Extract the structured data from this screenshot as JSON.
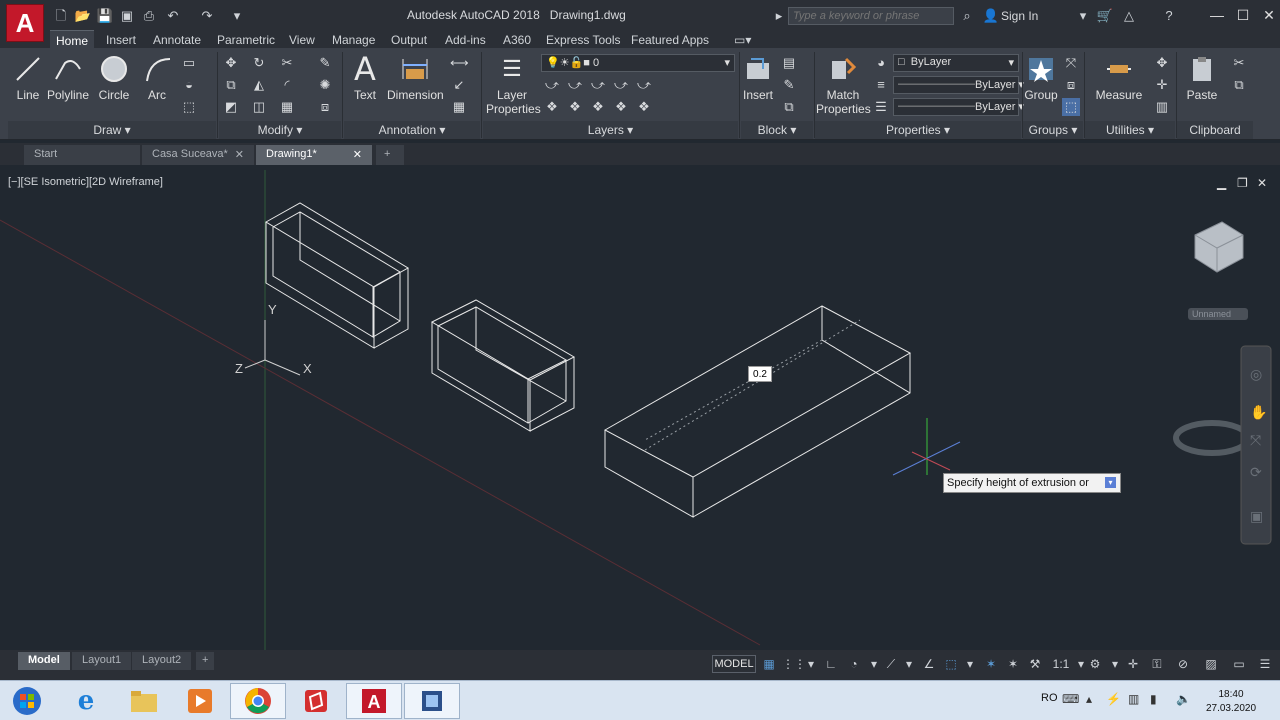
{
  "app": {
    "title": "Autodesk AutoCAD 2018",
    "document": "Drawing1.dwg",
    "logo_letter": "A"
  },
  "search": {
    "placeholder": "Type a keyword or phrase"
  },
  "signin": {
    "label": "Sign In"
  },
  "ribbon_tabs": [
    "Home",
    "Insert",
    "Annotate",
    "Parametric",
    "View",
    "Manage",
    "Output",
    "Add-ins",
    "A360",
    "Express Tools",
    "Featured Apps"
  ],
  "draw": {
    "line": "Line",
    "polyline": "Polyline",
    "circle": "Circle",
    "arc": "Arc",
    "footer": "Draw"
  },
  "modify": {
    "footer": "Modify"
  },
  "annotation": {
    "text": "Text",
    "dimension": "Dimension",
    "footer": "Annotation"
  },
  "layers": {
    "layer_properties_1": "Layer",
    "layer_properties_2": "Properties",
    "current_layer": "0",
    "footer": "Layers"
  },
  "block": {
    "insert": "Insert",
    "footer": "Block"
  },
  "properties": {
    "match_1": "Match",
    "match_2": "Properties",
    "color": "ByLayer",
    "linetype": "ByLayer",
    "lineweight": "ByLayer",
    "footer": "Properties"
  },
  "groups": {
    "group": "Group",
    "footer": "Groups"
  },
  "utilities": {
    "measure": "Measure",
    "footer": "Utilities"
  },
  "clipboard": {
    "paste": "Paste",
    "footer": "Clipboard"
  },
  "doc_tabs": [
    "Start",
    "Casa Suceava*",
    "Drawing1*"
  ],
  "viewport": {
    "label": "[−][SE Isometric][2D Wireframe]",
    "ucs_x": "X",
    "ucs_y": "Y",
    "ucs_z": "Z",
    "viewcube_label": "Unnamed"
  },
  "dim_input": "0.2",
  "tooltip": "Specify height of extrusion or",
  "layout_tabs": [
    "Model",
    "Layout1",
    "Layout2"
  ],
  "status": {
    "model": "MODEL",
    "scale": "1:1"
  },
  "clock": {
    "time": "18:40",
    "date": "27.03.2020",
    "lang": "RO"
  },
  "colors": {
    "canvas": "#212830",
    "ribbon": "#3c414a",
    "logo": "#c3182a"
  }
}
